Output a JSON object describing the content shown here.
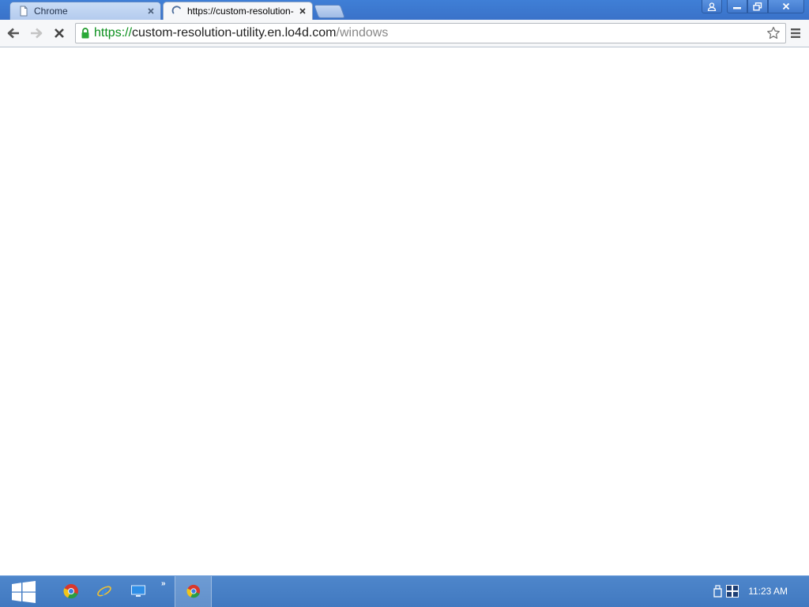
{
  "tabs": [
    {
      "title": "Chrome",
      "active": false,
      "icon": "page-icon"
    },
    {
      "title": "https://custom-resolution-",
      "active": true,
      "icon": "loading-spinner-icon"
    }
  ],
  "omnibox": {
    "scheme": "https://",
    "host": "custom-resolution-utility.en.lo4d.com",
    "path": "/windows",
    "secure": true
  },
  "taskbar": {
    "pinned": [
      "chrome-icon",
      "internet-explorer-icon",
      "remote-desktop-icon"
    ],
    "overflow_label": "»",
    "clock": "11:23 AM"
  },
  "colors": {
    "titlebar": "#3f7fd6",
    "taskbar": "#4a82c8",
    "secure_green": "#0a8f1c",
    "toolbar": "#f6f7f9"
  }
}
